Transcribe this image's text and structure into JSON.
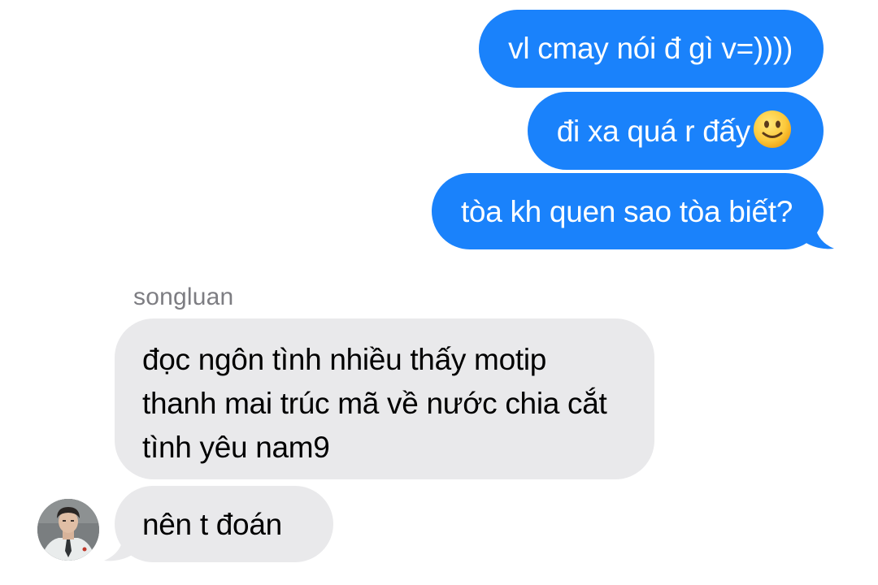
{
  "conversation": {
    "sent": [
      {
        "text": "vl cmay nói đ gì v=))))"
      },
      {
        "text": "đi xa quá r đấy",
        "emoji": "slightly-smiling-face-icon"
      },
      {
        "text": "tòa kh quen sao tòa biết?"
      }
    ],
    "received": {
      "sender_name": "songluan",
      "messages": [
        {
          "text": "đọc ngôn tình nhiều thấy motip thanh mai trúc mã về nước chia cắt tình yêu nam9"
        },
        {
          "text": "nên t đoán"
        }
      ]
    }
  },
  "colors": {
    "sent_bubble": "#1a82fb",
    "received_bubble": "#e9e9eb",
    "sender_name": "#7d7d82"
  }
}
